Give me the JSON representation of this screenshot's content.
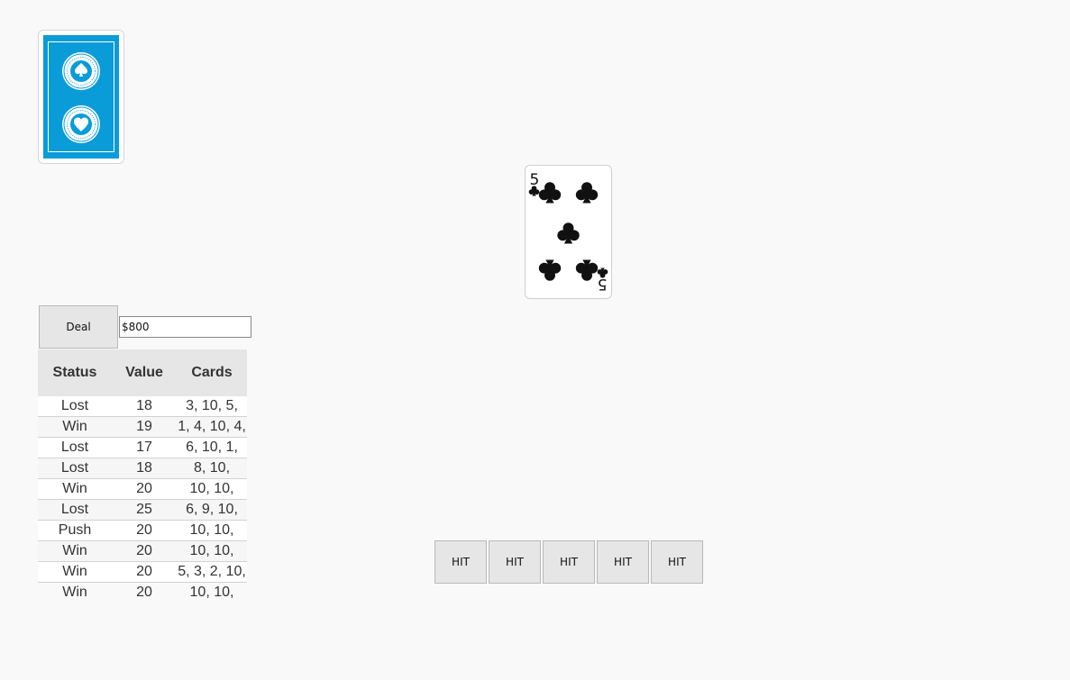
{
  "deck": {
    "icon": "card-back-icon",
    "emblem_icon": "acbl-emblem-icon",
    "back_color": "#0a9bd9"
  },
  "current_card": {
    "rank": "5",
    "suit": "clubs",
    "suit_icon": "club-icon",
    "color": "#111111"
  },
  "controls": {
    "deal_label": "Deal",
    "bankroll_value": "$800"
  },
  "history": {
    "headers": [
      "Status",
      "Value",
      "Cards"
    ],
    "rows": [
      {
        "status": "Lost",
        "value": "18",
        "cards": "3, 10, 5,"
      },
      {
        "status": "Win",
        "value": "19",
        "cards": "1, 4, 10, 4,"
      },
      {
        "status": "Lost",
        "value": "17",
        "cards": "6, 10, 1,"
      },
      {
        "status": "Lost",
        "value": "18",
        "cards": "8, 10,"
      },
      {
        "status": "Win",
        "value": "20",
        "cards": "10, 10,"
      },
      {
        "status": "Lost",
        "value": "25",
        "cards": "6, 9, 10,"
      },
      {
        "status": "Push",
        "value": "20",
        "cards": "10, 10,"
      },
      {
        "status": "Win",
        "value": "20",
        "cards": "10, 10,"
      },
      {
        "status": "Win",
        "value": "20",
        "cards": "5, 3, 2, 10,"
      },
      {
        "status": "Win",
        "value": "20",
        "cards": "10, 10,"
      }
    ]
  },
  "hit_buttons": [
    {
      "label": "HIT"
    },
    {
      "label": "HIT"
    },
    {
      "label": "HIT"
    },
    {
      "label": "HIT"
    },
    {
      "label": "HIT"
    }
  ]
}
